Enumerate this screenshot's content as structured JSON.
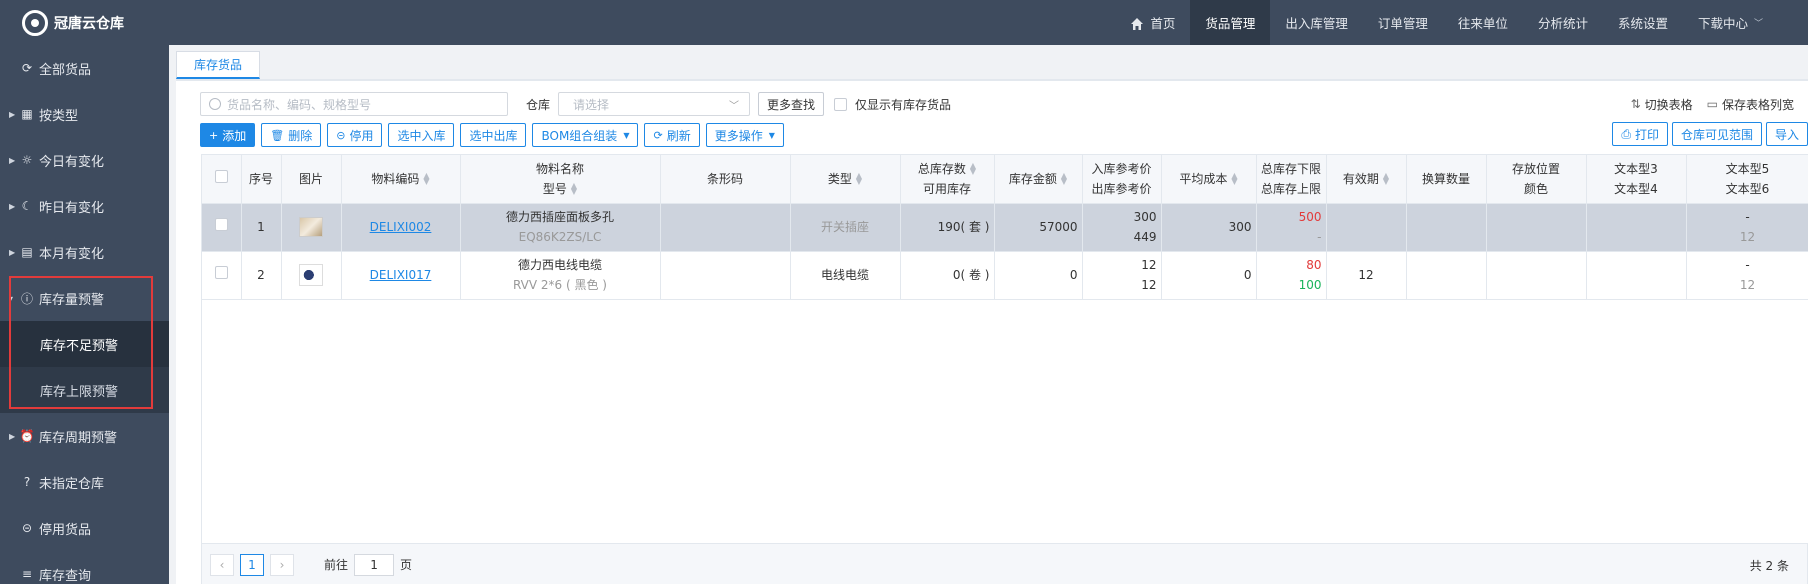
{
  "app": {
    "title": "冠唐云仓库"
  },
  "topnav": [
    {
      "label": "首页",
      "icon": "home-icon"
    },
    {
      "label": "货品管理",
      "active": true
    },
    {
      "label": "出入库管理"
    },
    {
      "label": "订单管理"
    },
    {
      "label": "往来单位"
    },
    {
      "label": "分析统计"
    },
    {
      "label": "系统设置"
    },
    {
      "label": "下载中心"
    }
  ],
  "sidebar": {
    "items": [
      {
        "label": "全部货品",
        "icon": "refresh-icon"
      },
      {
        "label": "按类型",
        "icon": "grid-icon"
      },
      {
        "label": "今日有变化",
        "icon": "sun-icon"
      },
      {
        "label": "昨日有变化",
        "icon": "moon-icon"
      },
      {
        "label": "本月有变化",
        "icon": "calendar-icon"
      },
      {
        "label": "库存量预警",
        "icon": "alert-icon"
      },
      {
        "label": "库存不足预警"
      },
      {
        "label": "库存上限预警"
      },
      {
        "label": "库存周期预警",
        "icon": "clock-icon"
      },
      {
        "label": "未指定仓库",
        "icon": "question-icon"
      },
      {
        "label": "停用货品",
        "icon": "stop-icon"
      },
      {
        "label": "库存查询",
        "icon": "list-icon"
      }
    ]
  },
  "tabs": [
    {
      "label": "库存货品"
    }
  ],
  "toolbar": {
    "search_placeholder": "货品名称、编码、规格型号",
    "warehouse_label": "仓库",
    "warehouse_placeholder": "请选择",
    "more_search": "更多查找",
    "only_stock_label": "仅显示有库存货品",
    "switch_table": "切换表格",
    "save_width": "保存表格列宽",
    "add": "添加",
    "delete": "删除",
    "disable": "停用",
    "select_in": "选中入库",
    "select_out": "选中出库",
    "bom": "BOM组合组装",
    "refresh": "刷新",
    "more_ops": "更多操作",
    "print": "打印",
    "visible_range": "仓库可见范围",
    "import": "导入"
  },
  "table": {
    "headers": {
      "seq": "序号",
      "image": "图片",
      "code": "物料编码",
      "name": "物料名称",
      "model": "型号",
      "barcode": "条形码",
      "type": "类型",
      "total_stock": "总库存数",
      "available": "可用库存",
      "amount": "库存金额",
      "in_price": "入库参考价",
      "out_price": "出库参考价",
      "avg_cost": "平均成本",
      "lower": "总库存下限",
      "upper": "总库存上限",
      "expiry": "有效期",
      "conv_qty": "换算数量",
      "location": "存放位置",
      "color": "颜色",
      "text3": "文本型3",
      "text4": "文本型4",
      "text5": "文本型5",
      "text6": "文本型6"
    },
    "rows": [
      {
        "seq": "1",
        "code": "DELIXI002",
        "name": "德力西插座面板多孔",
        "model": "EQ86K2ZS/LC",
        "type": "开关插座",
        "total_stock": "190( 套 )",
        "amount": "57000",
        "in_price": "300",
        "out_price": "449",
        "avg_cost": "300",
        "lower": "500",
        "upper": "-",
        "expiry": "",
        "text5": "-",
        "text6": "12"
      },
      {
        "seq": "2",
        "code": "DELIXI017",
        "name": "德力西电线电缆",
        "model": "RVV 2*6 ( 黑色 )",
        "type": "电线电缆",
        "total_stock": "0( 卷 )",
        "amount": "0",
        "in_price": "12",
        "out_price": "12",
        "avg_cost": "0",
        "lower": "80",
        "upper": "100",
        "expiry": "12",
        "text5": "-",
        "text6": "12"
      }
    ]
  },
  "pager": {
    "current": "1",
    "goto_label": "前往",
    "goto_value": "1",
    "page_unit": "页",
    "total": "共 2 条"
  }
}
